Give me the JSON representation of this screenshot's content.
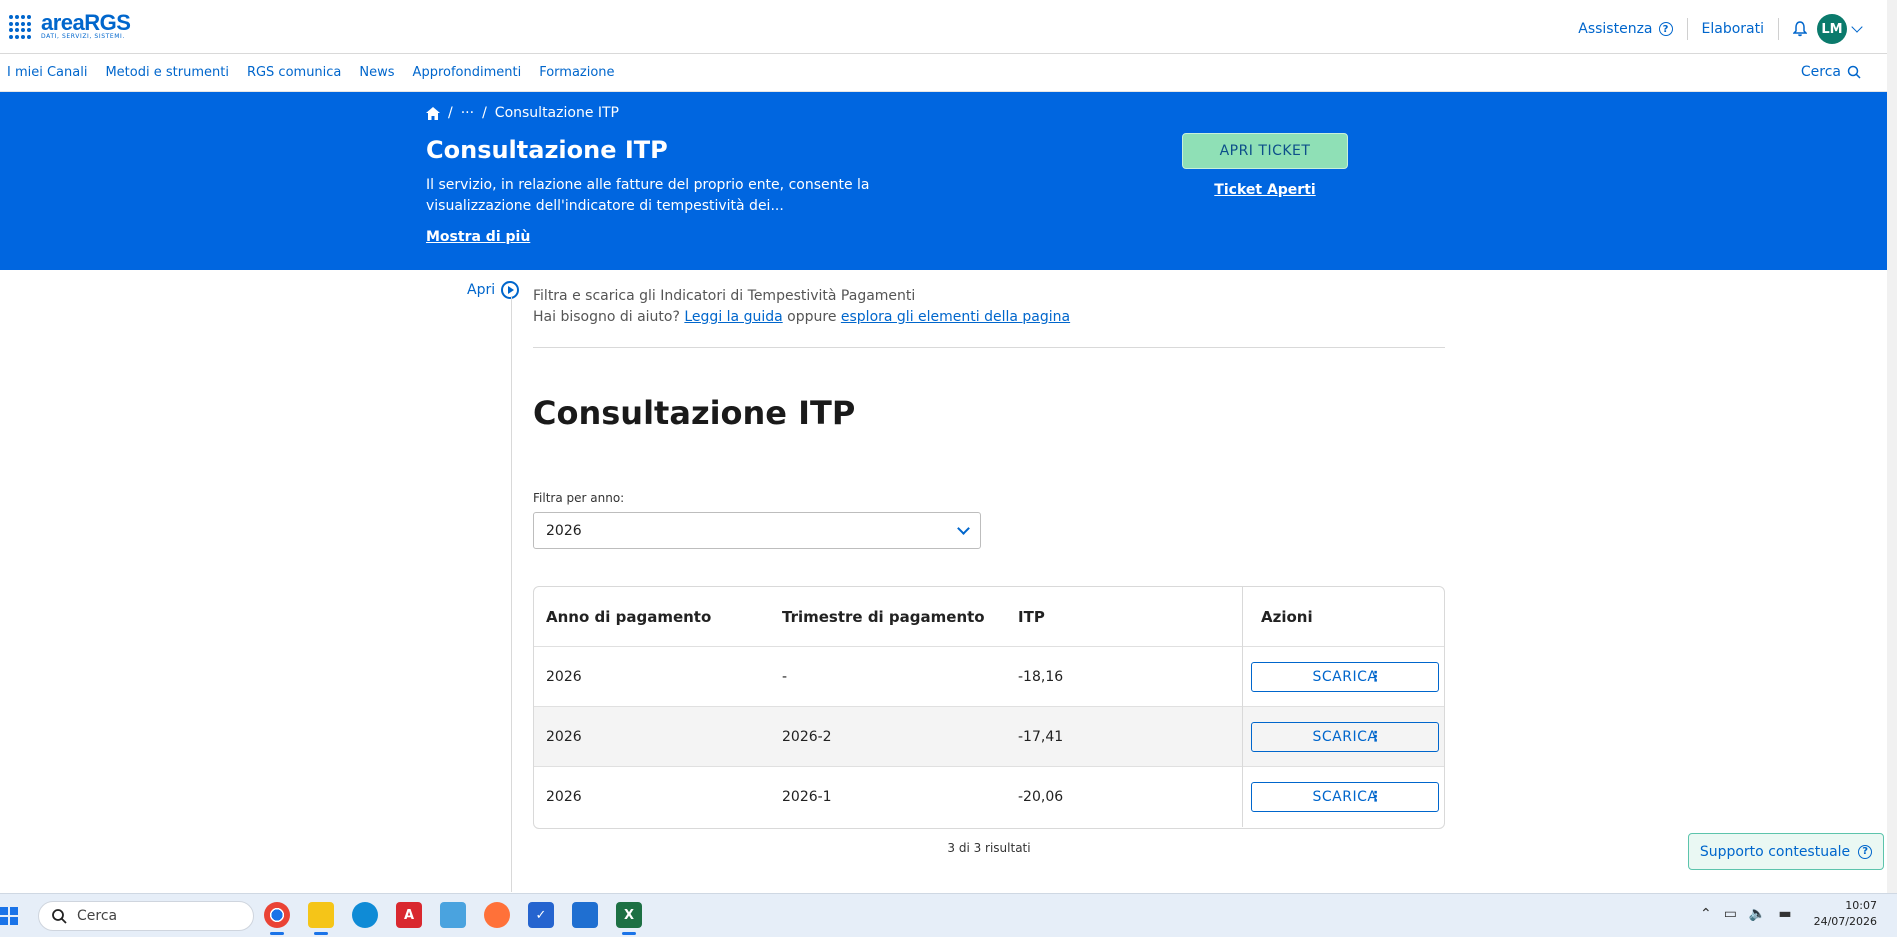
{
  "header": {
    "logo_name": "areaRGS",
    "logo_tagline": "DATI, SERVIZI, SISTEMI.",
    "assistenza": "Assistenza",
    "elaborati": "Elaborati",
    "avatar_initials": "LM"
  },
  "nav": {
    "items": [
      "I miei Canali",
      "Metodi e strumenti",
      "RGS comunica",
      "News",
      "Approfondimenti",
      "Formazione"
    ],
    "search": "Cerca"
  },
  "hero": {
    "breadcrumb_current": "Consultazione ITP",
    "breadcrumb_ellipsis": "···",
    "title": "Consultazione ITP",
    "description": "Il servizio, in relazione alle fatture del proprio ente, consente la visualizzazione dell'indicatore di tempestività dei...",
    "more": "Mostra di più",
    "ticket_button": "APRI TICKET",
    "ticket_open": "Ticket Aperti"
  },
  "content": {
    "side_open": "Apri",
    "intro_line1": "Filtra e scarica gli Indicatori di Tempestività Pagamenti",
    "intro_help": "Hai bisogno di aiuto?",
    "intro_guide": "Leggi la guida",
    "intro_or": "oppure",
    "intro_explore": "esplora gli elementi della pagina",
    "title": "Consultazione ITP",
    "filter_label": "Filtra per anno:",
    "filter_value": "2026",
    "table": {
      "headers": [
        "Anno di pagamento",
        "Trimestre di pagamento",
        "ITP",
        "Azioni"
      ],
      "rows": [
        {
          "anno": "2026",
          "trimestre": "-",
          "itp": "-18,16",
          "action": "SCARICA"
        },
        {
          "anno": "2026",
          "trimestre": "2026-2",
          "itp": "-17,41",
          "action": "SCARICA"
        },
        {
          "anno": "2026",
          "trimestre": "2026-1",
          "itp": "-20,06",
          "action": "SCARICA"
        }
      ]
    },
    "results": "3 di 3 risultati",
    "support": "Supporto contestuale"
  },
  "taskbar": {
    "search": "Cerca",
    "time": "10:07",
    "date": "24/07/2026"
  },
  "colors": {
    "accent": "#0066cc",
    "hero_bg": "#0066e0",
    "ticket_btn": "#8fe0b6",
    "avatar": "#0b7a6c"
  }
}
